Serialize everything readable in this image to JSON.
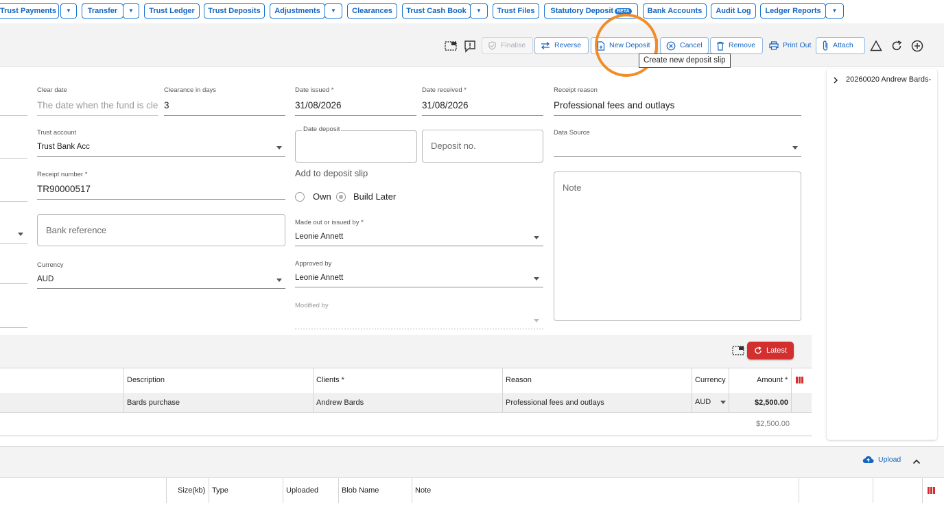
{
  "nav": {
    "items": [
      {
        "label": "Trust Payments",
        "caret": true
      },
      {
        "label": "Transfer",
        "caret": true
      },
      {
        "label": "Trust Ledger",
        "caret": false
      },
      {
        "label": "Trust Deposits",
        "caret": false
      },
      {
        "label": "Adjustments",
        "caret": true
      },
      {
        "label": "Clearances",
        "caret": false
      },
      {
        "label": "Trust Cash Book",
        "caret": true
      },
      {
        "label": "Trust Files",
        "caret": false
      },
      {
        "label": "Statutory Deposit",
        "badge": "BETA",
        "caret": false
      },
      {
        "label": "Bank Accounts",
        "caret": false
      },
      {
        "label": "Audit Log",
        "caret": false
      },
      {
        "label": "Ledger Reports",
        "caret": true
      }
    ]
  },
  "toolbar": {
    "finalise": "Finalise",
    "reverse": "Reverse",
    "new_deposit": "New Deposit",
    "cancel": "Cancel",
    "remove": "Remove",
    "print_out": "Print Out",
    "attach": "Attach",
    "tooltip": "Create new deposit slip"
  },
  "form": {
    "clear_date": {
      "label": "Clear date",
      "placeholder": "The date when the fund is clear"
    },
    "clearance_days": {
      "label": "Clearance in days",
      "value": "3"
    },
    "date_issued": {
      "label": "Date issued *",
      "value": "31/08/2026"
    },
    "date_received": {
      "label": "Date received *",
      "value": "31/08/2026"
    },
    "receipt_reason": {
      "label": "Receipt reason",
      "value": "Professional fees and outlays"
    },
    "trust_account": {
      "label": "Trust account",
      "value": "Trust Bank Acc"
    },
    "date_deposit": {
      "label": "Date deposit"
    },
    "deposit_no": {
      "placeholder": "Deposit no."
    },
    "data_source": {
      "label": "Data Source",
      "value": ""
    },
    "receipt_number": {
      "label": "Receipt number *",
      "value": "TR90000517"
    },
    "add_to_deposit_slip": "Add to deposit slip",
    "radio_own": "Own",
    "radio_build_later": "Build Later",
    "note": {
      "placeholder": "Note"
    },
    "bank_reference": {
      "placeholder": "Bank reference"
    },
    "made_out_by": {
      "label": "Made out or issued by *",
      "value": "Leonie Annett"
    },
    "currency": {
      "label": "Currency",
      "value": "AUD"
    },
    "approved_by": {
      "label": "Approved by",
      "value": "Leonie Annett"
    },
    "modified_by": {
      "label": "Modified by",
      "value": ""
    }
  },
  "side_panel": {
    "item": "20260020 Andrew Bards-"
  },
  "lines": {
    "latest_button": "Latest",
    "headers": {
      "description": "Description",
      "clients": "Clients *",
      "reason": "Reason",
      "currency": "Currency",
      "amount": "Amount *"
    },
    "rows": [
      {
        "description": "Bards purchase",
        "clients": "Andrew Bards",
        "reason": "Professional fees and outlays",
        "currency": "AUD",
        "amount": "$2,500.00"
      }
    ],
    "total": "$2,500.00"
  },
  "files": {
    "upload": "Upload",
    "headers": {
      "size": "Size(kb)",
      "type": "Type",
      "uploaded": "Uploaded",
      "blob_name": "Blob Name",
      "note": "Note"
    }
  },
  "colors": {
    "accent": "#1976d2",
    "latest_red": "#d32f2f",
    "highlight": "#f28c28"
  }
}
